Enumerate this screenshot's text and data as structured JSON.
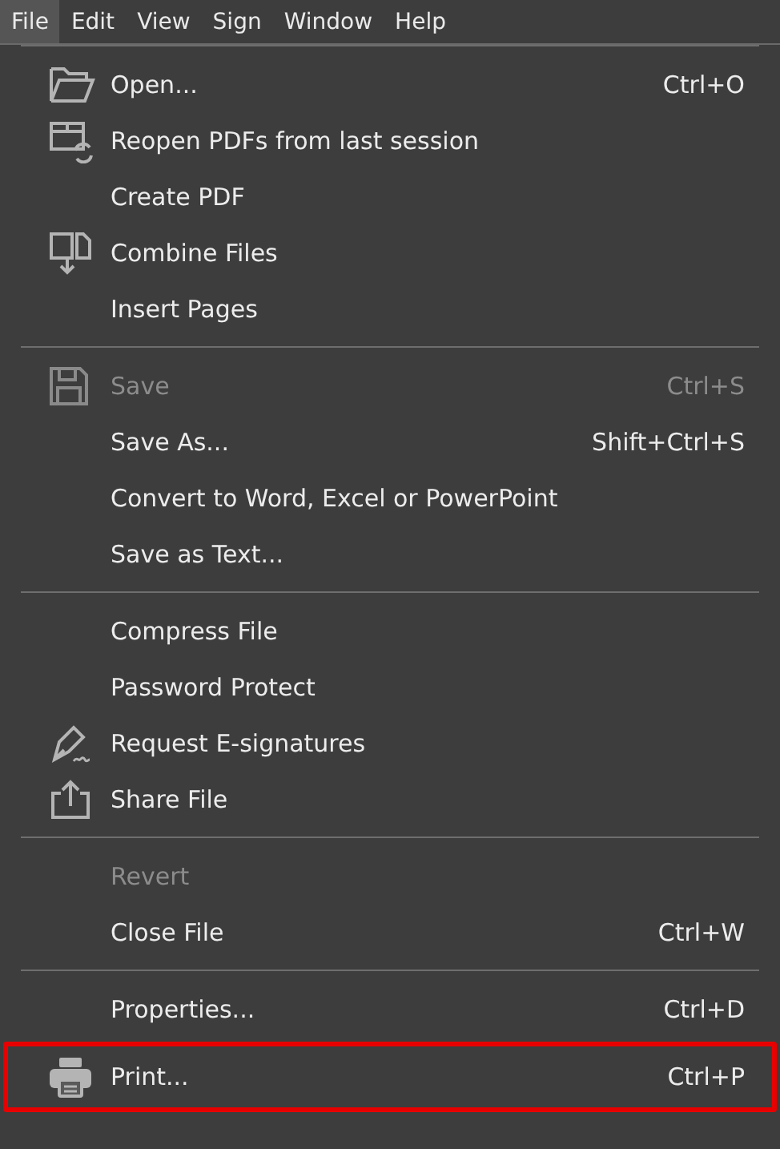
{
  "menubar": [
    {
      "label": "File",
      "selected": true
    },
    {
      "label": "Edit",
      "selected": false
    },
    {
      "label": "View",
      "selected": false
    },
    {
      "label": "Sign",
      "selected": false
    },
    {
      "label": "Window",
      "selected": false
    },
    {
      "label": "Help",
      "selected": false
    }
  ],
  "menu_groups": [
    {
      "items": [
        {
          "label": "Open...",
          "shortcut": "Ctrl+O",
          "disabled": false,
          "highlighted": false
        },
        {
          "label": "Reopen PDFs from last session",
          "disabled": false,
          "highlighted": false
        },
        {
          "label": "Create PDF",
          "disabled": false,
          "highlighted": false
        },
        {
          "label": "Combine Files",
          "disabled": false,
          "highlighted": false
        },
        {
          "label": "Insert Pages",
          "disabled": false,
          "highlighted": false
        }
      ]
    },
    {
      "items": [
        {
          "label": "Save",
          "shortcut": "Ctrl+S",
          "disabled": true,
          "highlighted": false
        },
        {
          "label": "Save As...",
          "shortcut": "Shift+Ctrl+S",
          "disabled": false,
          "highlighted": false
        },
        {
          "label": "Convert to Word, Excel or PowerPoint",
          "disabled": false,
          "highlighted": false
        },
        {
          "label": "Save as Text...",
          "disabled": false,
          "highlighted": false
        }
      ]
    },
    {
      "items": [
        {
          "label": "Compress File",
          "disabled": false,
          "highlighted": false
        },
        {
          "label": "Password Protect",
          "disabled": false,
          "highlighted": false
        },
        {
          "label": "Request E-signatures",
          "disabled": false,
          "highlighted": false
        },
        {
          "label": "Share File",
          "disabled": false,
          "highlighted": false
        }
      ]
    },
    {
      "items": [
        {
          "label": "Revert",
          "disabled": true,
          "highlighted": false
        },
        {
          "label": "Close File",
          "shortcut": "Ctrl+W",
          "disabled": false,
          "highlighted": false
        }
      ]
    },
    {
      "items": [
        {
          "label": "Properties...",
          "shortcut": "Ctrl+D",
          "disabled": false,
          "highlighted": false
        },
        {
          "label": "Print...",
          "shortcut": "Ctrl+P",
          "disabled": false,
          "highlighted": true
        }
      ]
    }
  ]
}
